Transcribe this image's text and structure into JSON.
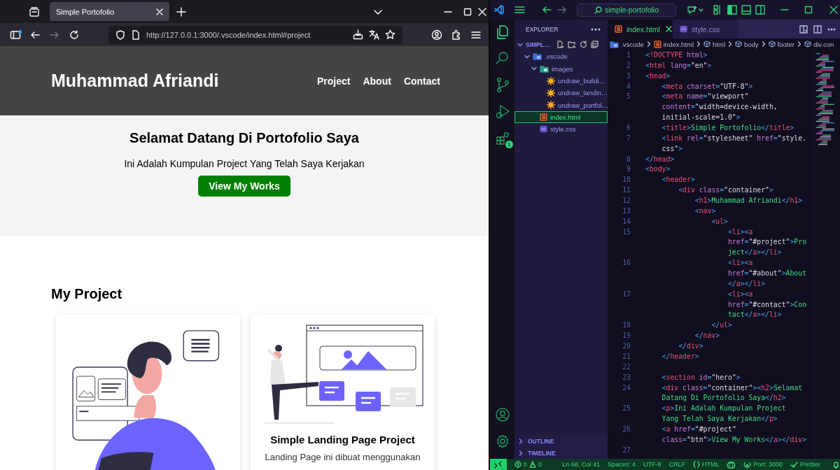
{
  "browser": {
    "tab": {
      "title": "Simple Portofolio"
    },
    "nav_buttons": [
      {
        "kind": "back",
        "disabled": false
      },
      {
        "kind": "forward",
        "disabled": true
      },
      {
        "kind": "reload",
        "disabled": false
      }
    ],
    "url": "http://127.0.0.1:3000/.vscode/index.html#project"
  },
  "site": {
    "header": {
      "name": "Muhammad Afriandi",
      "nav": [
        "Project",
        "About",
        "Contact"
      ]
    },
    "hero": {
      "title": "Selamat Datang Di Portofolio Saya",
      "text": "Ini Adalah Kumpulan Project Yang Telah Saya Kerjakan",
      "button": "View My Works"
    },
    "projects": {
      "title": "My Project",
      "cards": [
        {
          "kind": "person-screens"
        },
        {
          "kind": "person-webpage",
          "title": "Simple Landing Page Project",
          "description": "Landing Page ini dibuat menggunakan"
        }
      ]
    }
  },
  "editor_app": {
    "command_center": "simple-portofolio",
    "activity": [
      {
        "kind": "explorer",
        "selected": true
      },
      {
        "kind": "search",
        "selected": false
      },
      {
        "kind": "source-control",
        "selected": false
      },
      {
        "kind": "run",
        "selected": false
      },
      {
        "kind": "extensions",
        "selected": false,
        "badge": "1"
      }
    ],
    "explorer": {
      "title": "EXPLORER",
      "tree": [
        {
          "label": "SIMPL…",
          "kind": "root",
          "expanded": true,
          "children": [
            {
              "label": ".vscode",
              "kind": "folder",
              "expanded": true,
              "selected": false,
              "children": [
                {
                  "label": "images",
                  "kind": "image-folder",
                  "expanded": true,
                  "selected": false,
                  "children": [
                    {
                      "label": "undraw_buildi…",
                      "kind": "svg",
                      "selected": false
                    },
                    {
                      "label": "undraw_landin…",
                      "kind": "svg",
                      "selected": false
                    },
                    {
                      "label": "undraw_portfol…",
                      "kind": "svg",
                      "selected": false
                    }
                  ]
                },
                {
                  "label": "index.html",
                  "kind": "html",
                  "selected": true
                },
                {
                  "label": "style.css",
                  "kind": "css",
                  "selected": false
                }
              ]
            }
          ]
        }
      ],
      "sections": [
        {
          "label": "OUTLINE",
          "expanded": false
        },
        {
          "label": "TIMELINE",
          "expanded": false
        }
      ]
    },
    "tabs": [
      {
        "label": "index.html",
        "kind": "html",
        "selected": true
      },
      {
        "label": "style.css",
        "kind": "css",
        "selected": false
      }
    ],
    "breadcrumb": [
      {
        "label": ".vscode",
        "kind": "folder"
      },
      {
        "label": "index.html",
        "kind": "html"
      },
      {
        "label": "html",
        "kind": "symbol"
      },
      {
        "label": "body",
        "kind": "symbol"
      },
      {
        "label": "footer",
        "kind": "symbol"
      },
      {
        "label": "div.con",
        "kind": "symbol"
      }
    ],
    "code": [
      {
        "number": "1",
        "text": "<!DOCTYPE html>"
      },
      {
        "number": "2",
        "text": "<html lang=\"en\">"
      },
      {
        "number": "3",
        "text": "<head>"
      },
      {
        "number": "4",
        "text": "    <meta charset=\"UTF-8\">"
      },
      {
        "number": "5",
        "text": "    <meta name=\"viewport\""
      },
      {
        "text": "    content=\"width=device-width,"
      },
      {
        "text": "    initial-scale=1.0\">"
      },
      {
        "number": "6",
        "text": "    <title>Simple Portofolio</title>"
      },
      {
        "number": "7",
        "text": "    <link rel=\"stylesheet\" href=\"style."
      },
      {
        "text": "    css\">"
      },
      {
        "number": "8",
        "text": "</head>"
      },
      {
        "number": "9",
        "text": "<body>"
      },
      {
        "number": "10",
        "text": "    <header>"
      },
      {
        "number": "11",
        "text": "        <div class=\"container\">"
      },
      {
        "number": "12",
        "text": "            <h1>Muhammad Afriandi</h1>"
      },
      {
        "number": "13",
        "text": "            <nav>"
      },
      {
        "number": "14",
        "text": "                <ul>"
      },
      {
        "number": "15",
        "text": "                    <li><a"
      },
      {
        "text": "                    href=\"#project\">Pro"
      },
      {
        "text": "                    ject</a></li>"
      },
      {
        "number": "16",
        "text": "                    <li><a"
      },
      {
        "text": "                    href=\"#about\">About"
      },
      {
        "text": "                    </a></li>"
      },
      {
        "number": "17",
        "text": "                    <li><a"
      },
      {
        "text": "                    href=\"#contact\">Con"
      },
      {
        "text": "                    tact</a></li>"
      },
      {
        "number": "18",
        "text": "                </ul>"
      },
      {
        "number": "19",
        "text": "            </nav>"
      },
      {
        "number": "20",
        "text": "        </div>"
      },
      {
        "number": "21",
        "text": "    </header>"
      },
      {
        "number": "22"
      },
      {
        "number": "23",
        "text": "    <section id=\"hero\">"
      },
      {
        "number": "24",
        "text": "    <div class=\"container\"><h2>Selamat"
      },
      {
        "text": "    Datang Di Portofolio Saya</h2>"
      },
      {
        "number": "25",
        "text": "    <p>Ini Adalah Kumpulan Project"
      },
      {
        "text": "    Yang Telah Saya Kerjakan</p>"
      },
      {
        "number": "26",
        "text": "    <a href=\"#project\""
      },
      {
        "text": "    class=\"btn\">View My Works</a></div>"
      },
      {
        "number": "27"
      }
    ],
    "status_bar": {
      "errors": "0",
      "warnings": "0",
      "items": [
        {
          "kind": "text",
          "text": "Ln 68, Col 41"
        },
        {
          "kind": "text",
          "text": "Spaces: 4"
        },
        {
          "kind": "text",
          "text": "UTF-8"
        },
        {
          "kind": "text",
          "text": "CRLF"
        },
        {
          "kind": "language",
          "text": "HTML"
        },
        {
          "kind": "copilot"
        },
        {
          "kind": "port",
          "text": "Port: 3000"
        },
        {
          "kind": "check",
          "text": "Prettier"
        },
        {
          "kind": "bell"
        }
      ]
    }
  }
}
